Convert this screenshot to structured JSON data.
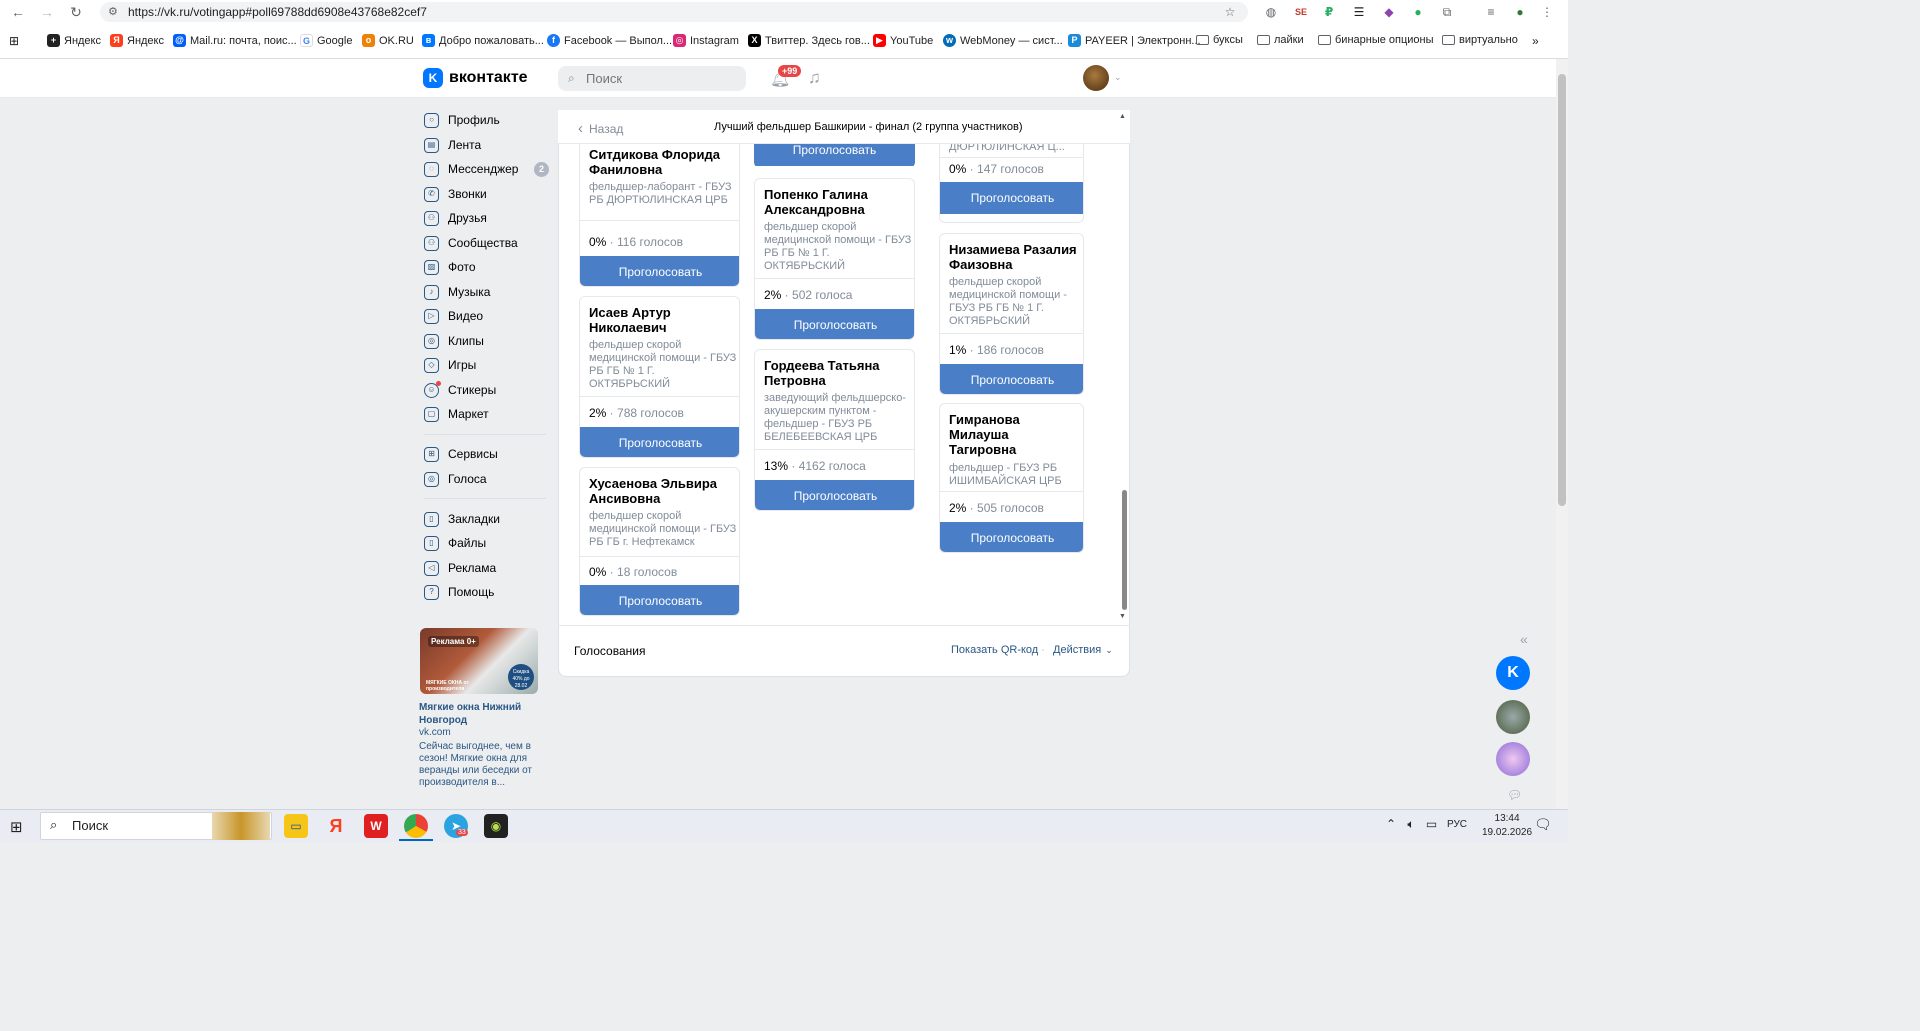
{
  "browser": {
    "url": "https://vk.ru/votingapp#poll69788dd6908e43768e82cef7",
    "bookmarks": [
      {
        "label": "Яндекс",
        "color": "#222222"
      },
      {
        "label": "Яндекс",
        "color": "#fc3f1d"
      },
      {
        "label": "Mail.ru: почта, поис...",
        "color": "#005ff9"
      },
      {
        "label": "Google",
        "color": "#4285f4"
      },
      {
        "label": "OK.RU",
        "color": "#ee8208"
      },
      {
        "label": "Добро пожаловать...",
        "color": "#0077ff"
      },
      {
        "label": "Facebook — Выпол...",
        "color": "#1877f2"
      },
      {
        "label": "Instagram",
        "color": "#d62976"
      },
      {
        "label": "Твиттер. Здесь гов...",
        "color": "#000000"
      },
      {
        "label": "YouTube",
        "color": "#ff0000"
      },
      {
        "label": "WebMoney — сист...",
        "color": "#036cb5"
      },
      {
        "label": "PAYEER | Электронн...",
        "color": "#1c8adb"
      },
      {
        "label": "буксы",
        "color": "folder"
      },
      {
        "label": "лайки",
        "color": "folder"
      },
      {
        "label": "бинарные опционы",
        "color": "folder"
      },
      {
        "label": "виртуально",
        "color": "folder"
      }
    ]
  },
  "vk": {
    "brand": "вконтакте",
    "search_placeholder": "Поиск",
    "notifications_badge": "+99"
  },
  "menu": {
    "items": [
      {
        "label": "Профиль",
        "icon": "profile-icon"
      },
      {
        "label": "Лента",
        "icon": "feed-icon"
      },
      {
        "label": "Мессенджер",
        "icon": "messenger-icon"
      },
      {
        "label": "Звонки",
        "icon": "phone-icon"
      },
      {
        "label": "Друзья",
        "icon": "friends-icon"
      },
      {
        "label": "Сообщества",
        "icon": "communities-icon"
      },
      {
        "label": "Фото",
        "icon": "photo-icon"
      },
      {
        "label": "Музыка",
        "icon": "music-icon"
      },
      {
        "label": "Видео",
        "icon": "video-icon"
      },
      {
        "label": "Клипы",
        "icon": "clips-icon"
      },
      {
        "label": "Игры",
        "icon": "games-icon"
      },
      {
        "label": "Стикеры",
        "icon": "stickers-icon"
      },
      {
        "label": "Маркет",
        "icon": "market-icon"
      },
      {
        "label": "Сервисы",
        "icon": "services-icon"
      },
      {
        "label": "Голоса",
        "icon": "votes-icon"
      },
      {
        "label": "Закладки",
        "icon": "bookmarks-icon"
      },
      {
        "label": "Файлы",
        "icon": "files-icon"
      },
      {
        "label": "Реклама",
        "icon": "ads-icon"
      },
      {
        "label": "Помощь",
        "icon": "help-icon"
      }
    ],
    "messenger_count": "2"
  },
  "ad": {
    "badge": "Реклама 0+",
    "brand": "МЯГКИЕ ОКНА от производителя",
    "circle": "Скидка 40% до 28.02",
    "title": "Мягкие окна Нижний Новгород",
    "domain": "vk.com",
    "text": "Сейчас выгоднее, чем в сезон! Мягкие окна для веранды или беседки от производителя в..."
  },
  "poll": {
    "back": "Назад",
    "title": "Лучший фельдшер Башкирии - финал (2 группа участников)",
    "vote_label": "Проголосовать",
    "col1": [
      {
        "name": "Ситдикова Флорида Фаниловна",
        "desc": "фельдшер-лаборант - ГБУЗ РБ ДЮРТЮЛИНСКАЯ ЦРБ",
        "pct": "0%",
        "votes": "116 голосов"
      },
      {
        "name": "Исаев Артур Николаевич",
        "desc": "фельдшер скорой медицинской помощи - ГБУЗ РБ ГБ № 1 Г. ОКТЯБРЬСКИЙ",
        "pct": "2%",
        "votes": "788 голосов"
      },
      {
        "name": "Хусаенова Эльвира Ансивовна",
        "desc": "фельдшер скорой медицинской помощи - ГБУЗ РБ ГБ г. Нефтекамск",
        "pct": "0%",
        "votes": "18 голосов"
      }
    ],
    "col2": [
      {
        "name": "Попенко Галина Александровна",
        "desc": "фельдшер скорой медицинской помощи - ГБУЗ РБ ГБ № 1 Г. ОКТЯБРЬСКИЙ",
        "pct": "2%",
        "votes": "502 голоса"
      },
      {
        "name": "Гордеева Татьяна Петровна",
        "desc": "заведующий фельдшерско-акушерским пунктом - фельдшер - ГБУЗ РБ БЕЛЕБЕЕВСКАЯ ЦРБ",
        "pct": "13%",
        "votes": "4162 голоса"
      }
    ],
    "col3_partial": {
      "desc_tail": "ДЮРТЮЛИНСКАЯ Ц...",
      "pct": "0%",
      "votes": "147 голосов"
    },
    "col3": [
      {
        "name": "Низамиева Разалия Фаизовна",
        "desc": "фельдшер скорой медицинской помощи - ГБУЗ РБ ГБ № 1 Г. ОКТЯБРЬСКИЙ",
        "pct": "1%",
        "votes": "186 голосов"
      },
      {
        "name": "Гимранова Милауша Тагировна",
        "desc": "фельдшер - ГБУЗ РБ ИШИМБАЙСКАЯ ЦРБ",
        "pct": "2%",
        "votes": "505 голосов"
      }
    ],
    "footer_title": "Голосования",
    "qr": "Показать QR-код",
    "actions": "Действия"
  },
  "taskbar": {
    "search": "Поиск",
    "time": "13:44",
    "date": "19.02.2026",
    "lang": "РУС",
    "telegram_badge": "33"
  }
}
